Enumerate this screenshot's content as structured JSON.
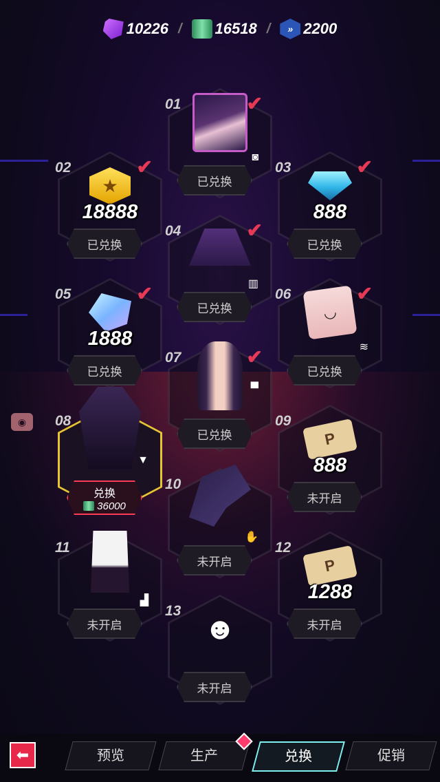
{
  "currencies": [
    {
      "icon": "purple-gem-icon",
      "value": "10226"
    },
    {
      "icon": "green-scroll-icon",
      "value": "16518"
    },
    {
      "icon": "blue-chevron-badge-icon",
      "value": "2200"
    }
  ],
  "nodes": [
    {
      "num": "01",
      "item": "character-avatar",
      "status": "已兑换",
      "redeemed": true
    },
    {
      "num": "02",
      "item": "gold-coin",
      "amount": "18888",
      "status": "已兑换",
      "redeemed": true
    },
    {
      "num": "03",
      "item": "blue-diamond",
      "amount": "888",
      "status": "已兑换",
      "redeemed": true
    },
    {
      "num": "04",
      "item": "purple-skirt",
      "status": "已兑换",
      "redeemed": true
    },
    {
      "num": "05",
      "item": "crystal",
      "amount": "1888",
      "status": "已兑换",
      "redeemed": true
    },
    {
      "num": "06",
      "item": "eye-makeup",
      "status": "已兑换",
      "redeemed": true
    },
    {
      "num": "07",
      "item": "hairstyle",
      "status": "已兑换",
      "redeemed": true
    },
    {
      "num": "08",
      "item": "dress",
      "status": "兑换",
      "cost": "36000",
      "redeemed": false
    },
    {
      "num": "09",
      "item": "ticket",
      "amount": "888",
      "status": "未开启",
      "redeemed": false
    },
    {
      "num": "10",
      "item": "gloves",
      "status": "未开启",
      "redeemed": false
    },
    {
      "num": "11",
      "item": "boots",
      "status": "未开启",
      "redeemed": false
    },
    {
      "num": "12",
      "item": "ticket",
      "amount": "1288",
      "status": "未开启",
      "redeemed": false
    },
    {
      "num": "13",
      "item": "pose",
      "status": "未开启",
      "redeemed": false
    }
  ],
  "tabs": [
    {
      "label": "预览"
    },
    {
      "label": "生产"
    },
    {
      "label": "兑换",
      "active": true
    },
    {
      "label": "促销"
    }
  ],
  "colors": {
    "accent": "#e8284a",
    "check": "#e43a55",
    "active_tab": "#7ff0f0",
    "highlight": "#e6c433"
  }
}
